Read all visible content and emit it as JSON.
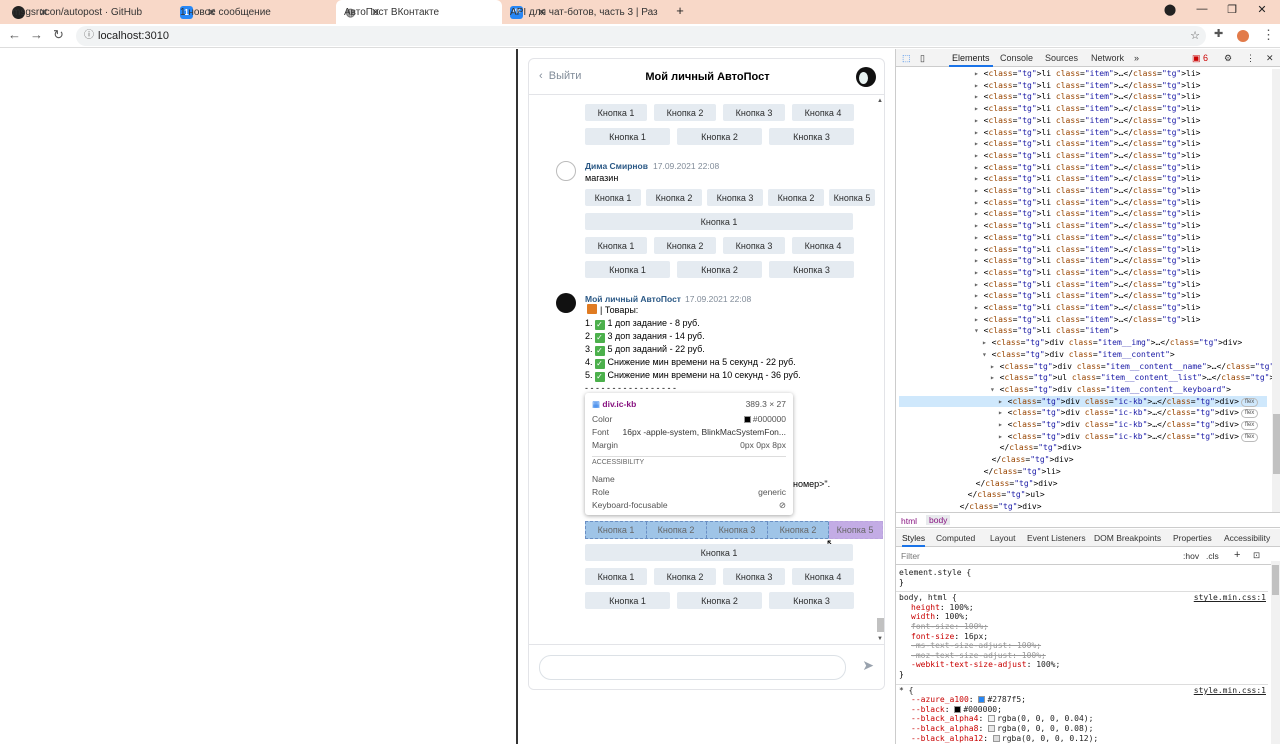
{
  "tabs": [
    {
      "title": "msgsrucon/autopost · GitHub",
      "fav": "github",
      "color": "#222"
    },
    {
      "title": "1 новое сообщение",
      "fav": "1",
      "color": "#2787f5"
    },
    {
      "title": "АвтоПост ВКонтакте",
      "fav": "globe",
      "color": "#888"
    },
    {
      "title": "API для чат-ботов, часть 3 | Раз",
      "fav": "VK",
      "color": "#2787f5"
    }
  ],
  "address": "localhost:3010",
  "vk": {
    "back": "Выйти",
    "title": "Мой личный АвтоПост",
    "top_rows": [
      [
        "Кнопка 1",
        "Кнопка 2",
        "Кнопка 3",
        "Кнопка 4"
      ],
      [
        "Кнопка 1",
        "Кнопка 2",
        "Кнопка 3"
      ]
    ],
    "msg1": {
      "name": "Дима Смирнов",
      "time": "17.09.2021 22:08",
      "text": "магазин"
    },
    "msg1_rows": [
      [
        "Кнопка 1",
        "Кнопка 2",
        "Кнопка 3",
        "Кнопка 2",
        "Кнопка 5"
      ],
      [
        "Кнопка 1"
      ],
      [
        "Кнопка 1",
        "Кнопка 2",
        "Кнопка 3",
        "Кнопка 4"
      ],
      [
        "Кнопка 1",
        "Кнопка 2",
        "Кнопка 3"
      ]
    ],
    "msg2": {
      "name": "Мой личный АвтоПост",
      "time": "17.09.2021 22:08",
      "lines": [
        "| Товары:",
        "1 доп задание - 8 руб.",
        "3 доп задания - 14 руб.",
        "5 доп заданий - 22 руб.",
        "Снижение мин времени на 5 секунд - 22 руб.",
        "Снижение мин времени на 10 секунд - 36 руб."
      ],
      "nums": [
        "1.",
        "2.",
        "3.",
        "4.",
        "5."
      ],
      "divider": "- - - - - - - - - - - - - - - - -",
      "tail": "номер>\"."
    },
    "hl_row": [
      "Кнопка 1",
      "Кнопка 2",
      "Кнопка 3",
      "Кнопка 2",
      "Кнопка 5"
    ],
    "bottom_rows": [
      [
        "Кнопка 1"
      ],
      [
        "Кнопка 1",
        "Кнопка 2",
        "Кнопка 3",
        "Кнопка 4"
      ],
      [
        "Кнопка 1",
        "Кнопка 2",
        "Кнопка 3"
      ]
    ]
  },
  "tooltip": {
    "selector": "div.ic-kb",
    "size": "389.3 × 27",
    "color_label": "Color",
    "color_value": "#000000",
    "font_label": "Font",
    "font_value": "16px -apple-system, BlinkMacSystemFon...",
    "margin_label": "Margin",
    "margin_value": "0px 0px 8px",
    "a11y": "ACCESSIBILITY",
    "name_label": "Name",
    "role_label": "Role",
    "role_value": "generic",
    "kf_label": "Keyboard-focusable"
  },
  "devtools": {
    "tabs": [
      "Elements",
      "Console",
      "Sources",
      "Network"
    ],
    "issues": "6",
    "crumbs": [
      "html",
      "body"
    ],
    "style_tabs": [
      "Styles",
      "Computed",
      "Layout",
      "Event Listeners",
      "DOM Breakpoints",
      "Properties",
      "Accessibility"
    ],
    "filter": "Filter",
    "hov": ":hov",
    "cls": ".cls",
    "li_line": "<li class=\"item\">…</li>",
    "tree_tail": [
      {
        "indent": 0,
        "html": "<li class=\"item\">"
      },
      {
        "indent": 1,
        "html": "<div class=\"item__img\">…</div>"
      },
      {
        "indent": 1,
        "html": "<div class=\"item__content\">"
      },
      {
        "indent": 2,
        "html": "<div class=\"item__content__name\">…</div>"
      },
      {
        "indent": 2,
        "html": "<ul class=\"item__content__list\">…</ul>"
      },
      {
        "indent": 2,
        "html": "<div class=\"item__content__keyboard\">"
      },
      {
        "indent": 3,
        "html": "<div class=\"ic-kb\">…</div>",
        "flex": true,
        "sel": true
      },
      {
        "indent": 3,
        "html": "<div class=\"ic-kb\">…</div>",
        "flex": true
      },
      {
        "indent": 3,
        "html": "<div class=\"ic-kb\">…</div>",
        "flex": true
      },
      {
        "indent": 3,
        "html": "<div class=\"ic-kb\">…</div>",
        "flex": true
      },
      {
        "indent": 2,
        "html": "</div>"
      },
      {
        "indent": 1,
        "html": "</div>"
      },
      {
        "indent": 0,
        "html": "</li>"
      },
      {
        "indent": -1,
        "html": "</div>"
      },
      {
        "indent": -2,
        "html": "</ul>"
      },
      {
        "indent": -3,
        "html": "</div>"
      }
    ],
    "flex_label": "flex",
    "styles": [
      {
        "t": "sel",
        "v": "element.style {"
      },
      {
        "t": "plain",
        "v": "}"
      },
      {
        "t": "sel",
        "v": "body, html {",
        "src": "style.min.css:1"
      },
      {
        "t": "prop",
        "n": "height",
        "val": "100%;"
      },
      {
        "t": "prop",
        "n": "width",
        "val": "100%;"
      },
      {
        "t": "strike",
        "v": "font-size: 100%;"
      },
      {
        "t": "prop",
        "n": "font-size",
        "val": "16px;"
      },
      {
        "t": "strike",
        "v": "-ms-text-size-adjust: 100%;"
      },
      {
        "t": "strike",
        "v": "-moz-text-size-adjust: 100%;"
      },
      {
        "t": "prop",
        "n": "-webkit-text-size-adjust",
        "val": "100%;"
      },
      {
        "t": "plain",
        "v": "}"
      },
      {
        "t": "sel",
        "v": "* {",
        "src": "style.min.css:1"
      },
      {
        "t": "var",
        "n": "--azure_a100",
        "val": "#2787f5;",
        "c": "#2787f5"
      },
      {
        "t": "var",
        "n": "--black",
        "val": "#000000;",
        "c": "#000000"
      },
      {
        "t": "var",
        "n": "--black_alpha4",
        "val": "rgba(0, 0, 0, 0.04);",
        "c": "#f4f4f4"
      },
      {
        "t": "var",
        "n": "--black_alpha8",
        "val": "rgba(0, 0, 0, 0.08);",
        "c": "#eaeaea"
      },
      {
        "t": "var",
        "n": "--black_alpha12",
        "val": "rgba(0, 0, 0, 0.12);",
        "c": "#dddddd"
      }
    ]
  }
}
